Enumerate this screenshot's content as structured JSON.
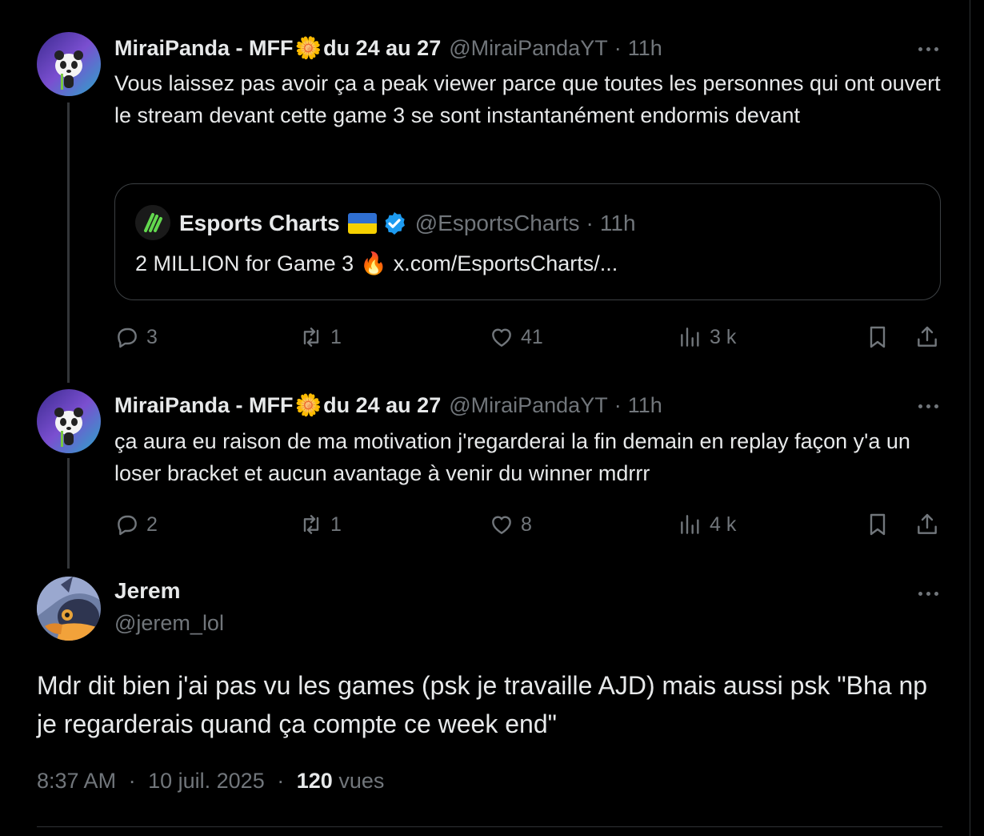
{
  "colors": {
    "background": "#000000",
    "text": "#e7e9ea",
    "muted": "#71767b",
    "verified": "#1d9bf0"
  },
  "tweets": [
    {
      "author": "MiraiPanda - MFF",
      "author_suffix": "du 24 au 27",
      "emoji": "🌼",
      "handle": "@MiraiPandaYT",
      "separator": "·",
      "time": "11h",
      "text": "Vous laissez pas avoir ça a peak viewer parce que toutes les personnes qui ont ouvert le stream devant cette game 3 se sont instantanément endormis devant",
      "quote": {
        "author": "Esports Charts",
        "handle": "@EsportsCharts",
        "separator": "·",
        "time": "11h",
        "text": "2 MILLION for Game 3",
        "emoji": "🔥",
        "link": "x.com/EsportsCharts/..."
      },
      "stats": {
        "replies": "3",
        "retweets": "1",
        "likes": "41",
        "views": "3 k"
      },
      "icons": [
        "reply-icon",
        "retweet-icon",
        "like-icon",
        "views-icon",
        "bookmark-icon",
        "share-icon"
      ]
    },
    {
      "author": "MiraiPanda - MFF",
      "author_suffix": "du 24 au 27",
      "emoji": "🌼",
      "handle": "@MiraiPandaYT",
      "separator": "·",
      "time": "11h",
      "text": "ça aura eu raison de ma motivation j'regarderai la fin demain en replay façon y'a un loser bracket et aucun avantage à venir du winner mdrrr",
      "stats": {
        "replies": "2",
        "retweets": "1",
        "likes": "8",
        "views": "4 k"
      }
    }
  ],
  "main_tweet": {
    "author": "Jerem",
    "handle": "@jerem_lol",
    "text": "Mdr dit bien j'ai pas vu les games (psk je travaille AJD) mais aussi psk \"Bha np je regarderais quand ça compte ce week end\"",
    "time": "8:37 AM",
    "date": "10 juil. 2025",
    "separator": "·",
    "views_count": "120",
    "views_label": "vues"
  }
}
